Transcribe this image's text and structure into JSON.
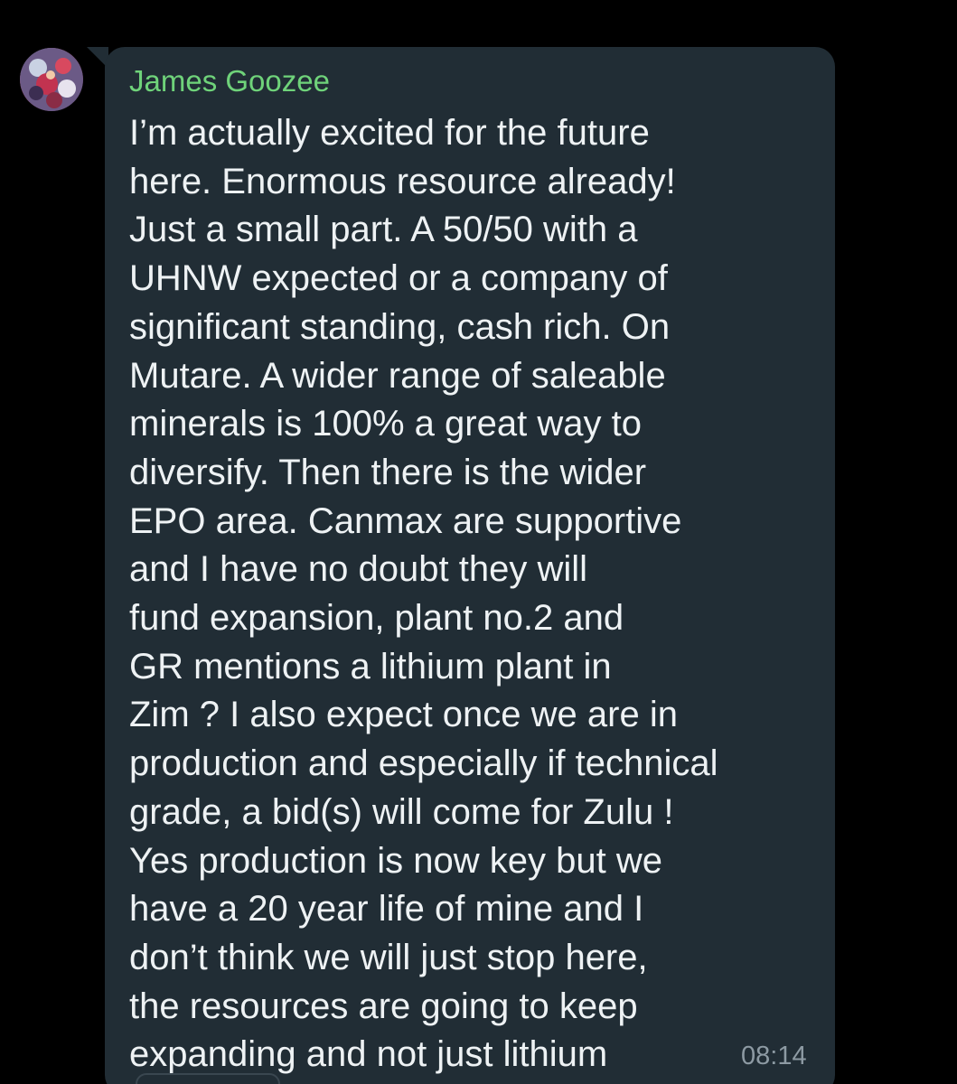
{
  "chat": {
    "accent_color": "#6fd37a",
    "bubble_color": "#212d35",
    "message": {
      "sender": "James Goozee",
      "avatar_icon": "profile-photo",
      "lines": [
        "I’m actually excited for the future",
        "here. Enormous resource already!",
        "Just a small part. A 50/50 with a",
        "UHNW expected or a company of",
        "significant standing, cash rich. On",
        "Mutare. A wider range of saleable",
        "minerals is 100% a great way to",
        "diversify. Then there is the wider",
        "EPO area. Canmax are supportive",
        "and I have no doubt they will",
        "fund expansion, plant no.2 and",
        "GR mentions a lithium plant in",
        "Zim ? I also expect once we are in",
        "production and especially if technical",
        "grade, a bid(s) will come for Zulu !",
        "Yes production is now key but we",
        "have a 20 year life of mine and I",
        "don’t think we will just stop here,",
        "the resources are going to keep",
        "expanding and not just lithium"
      ],
      "time": "08:14"
    }
  }
}
